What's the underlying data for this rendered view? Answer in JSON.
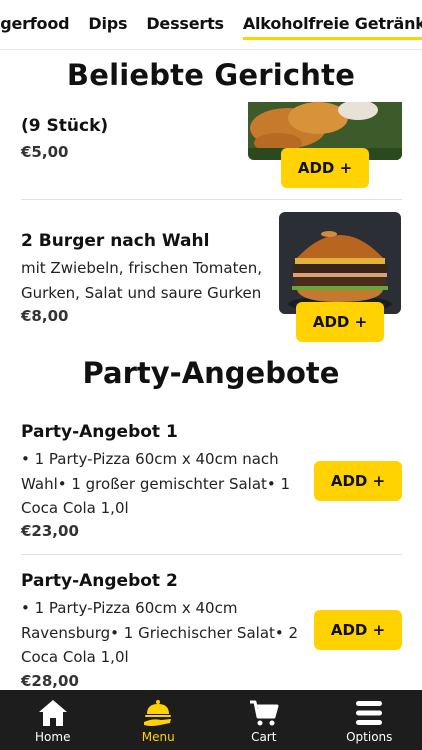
{
  "category_nav": {
    "items": [
      "ngerfood",
      "Dips",
      "Desserts",
      "Alkoholfreie Getränke"
    ],
    "active_index": 3
  },
  "popular": {
    "title": "Beliebte Gerichte",
    "items": [
      {
        "name_fragment": "(9 Stück)",
        "price": "€5,00",
        "add_label": "ADD +"
      },
      {
        "name": "2 Burger nach Wahl",
        "description_lines": [
          "mit Zwiebeln, frischen Tomaten,",
          "Gurken, Salat und saure Gurken"
        ],
        "price": "€8,00",
        "add_label": "ADD +"
      }
    ]
  },
  "party": {
    "title": "Party-Angebote",
    "items": [
      {
        "name": "Party-Angebot 1",
        "description_lines": [
          "• 1 Party-Pizza 60cm x 40cm nach",
          "Wahl• 1 großer gemischter Salat• 1",
          "Coca Cola 1,0l"
        ],
        "price": "€23,00",
        "add_label": "ADD +"
      },
      {
        "name": "Party-Angebot 2",
        "description_lines": [
          "• 1 Party-Pizza 60cm x 40cm",
          "Ravensburg• 1 Griechischer Salat• 2",
          "Coca Cola 1,0l"
        ],
        "price": "€28,00",
        "add_label": "ADD +"
      }
    ]
  },
  "bottom_nav": {
    "tabs": [
      {
        "label": "Home",
        "icon": "home-icon"
      },
      {
        "label": "Menu",
        "icon": "food-cloche-icon"
      },
      {
        "label": "Cart",
        "icon": "cart-icon"
      },
      {
        "label": "Options",
        "icon": "menu-lines-icon"
      }
    ],
    "active_index": 1
  },
  "colors": {
    "accent": "#ffd200",
    "nav_background": "#1d1d1d"
  }
}
